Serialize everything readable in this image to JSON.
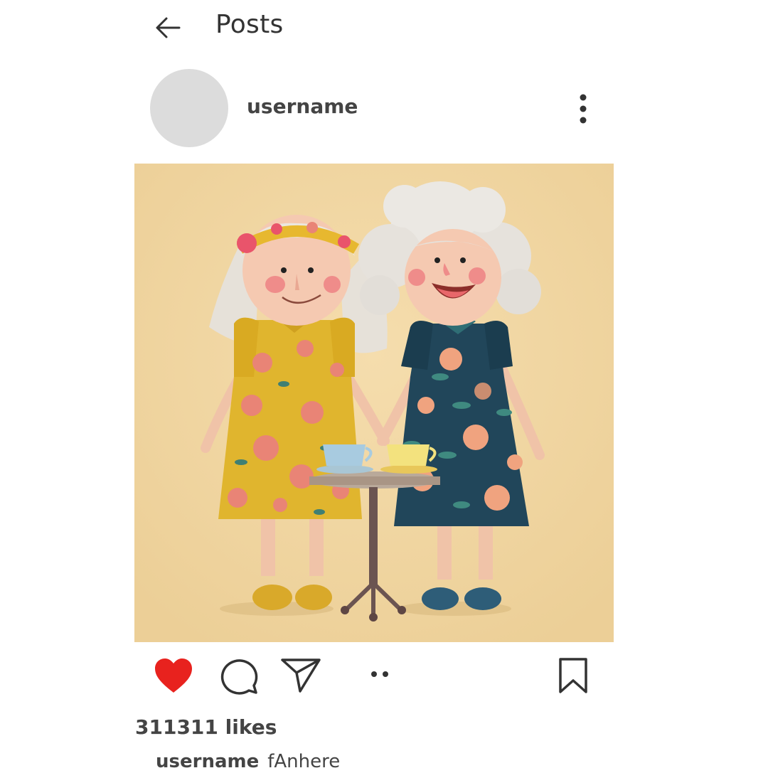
{
  "header": {
    "title": "Posts",
    "back_icon": "arrow-left-icon"
  },
  "post": {
    "username": "username",
    "menu_icon": "more-vertical-icon",
    "likes_text": "311311 likes",
    "caption_user": "username",
    "caption_text": "fAnhere",
    "image_colors": {
      "background": "#f1d8a4",
      "yellow_dress": "#e0b52e",
      "blue_dress": "#21465a",
      "hair": "#e9e5df",
      "skin": "#f5c9b1"
    }
  },
  "actions": {
    "like_icon": "heart-filled-icon",
    "comment_icon": "speech-bubble-icon",
    "share_icon": "paper-plane-icon",
    "dots_icon": "carousel-dots-icon",
    "save_icon": "bookmark-icon",
    "like_color": "#e8221e"
  }
}
